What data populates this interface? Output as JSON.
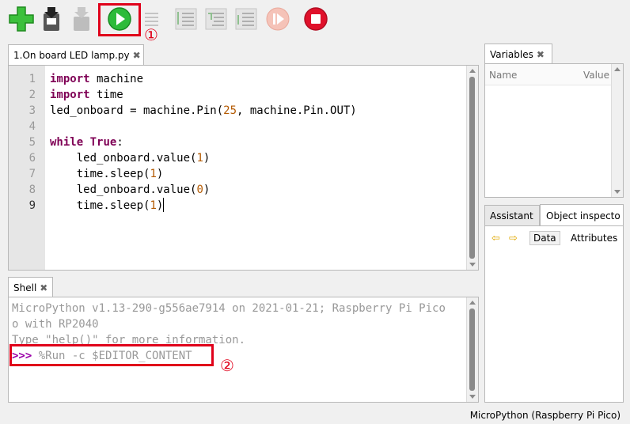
{
  "toolbar": {
    "buttons": [
      "new-file",
      "save",
      "load",
      "run",
      "debug",
      "step-over",
      "step-into",
      "step-out",
      "resume",
      "stop"
    ]
  },
  "annotations": {
    "one": "①",
    "two": "②"
  },
  "editor": {
    "tab_label": "1.On board LED lamp.py",
    "tab_close": "✖",
    "line_numbers": [
      "1",
      "2",
      "3",
      "4",
      "5",
      "6",
      "7",
      "8",
      "9"
    ],
    "code": {
      "l1_kw": "import",
      "l1_rest": " machine",
      "l2_kw": "import",
      "l2_rest": " time",
      "l3_a": "led_onboard = machine.Pin(",
      "l3_num": "25",
      "l3_b": ", machine.Pin.OUT)",
      "l5_kw1": "while",
      "l5_sp": " ",
      "l5_kw2": "True",
      "l5_end": ":",
      "l6_a": "    led_onboard.value(",
      "l6_num": "1",
      "l6_b": ")",
      "l7_a": "    time.sleep(",
      "l7_num": "1",
      "l7_b": ")",
      "l8_a": "    led_onboard.value(",
      "l8_num": "0",
      "l8_b": ")",
      "l9_a": "    time.sleep(",
      "l9_num": "1",
      "l9_b": ")"
    }
  },
  "shell": {
    "tab_label": "Shell",
    "tab_close": "✖",
    "line1": "MicroPython v1.13-290-g556ae7914 on 2021-01-21; Raspberry Pi Pico",
    "line2": "o with RP2040",
    "line3": "Type \"help()\" for more information.",
    "prompt": ">>>",
    "command": " %Run -c $EDITOR_CONTENT"
  },
  "variables": {
    "tab_label": "Variables",
    "tab_close": "✖",
    "col_name": "Name",
    "col_value": "Value"
  },
  "inspector": {
    "tab_assistant": "Assistant",
    "tab_object": "Object inspecto",
    "btn_data": "Data",
    "btn_attributes": "Attributes"
  },
  "status": {
    "interpreter": "MicroPython (Raspberry Pi Pico)"
  },
  "colors": {
    "annotation": "#e0001a",
    "run_green": "#2dbb3a",
    "stop_red": "#e0112b"
  }
}
